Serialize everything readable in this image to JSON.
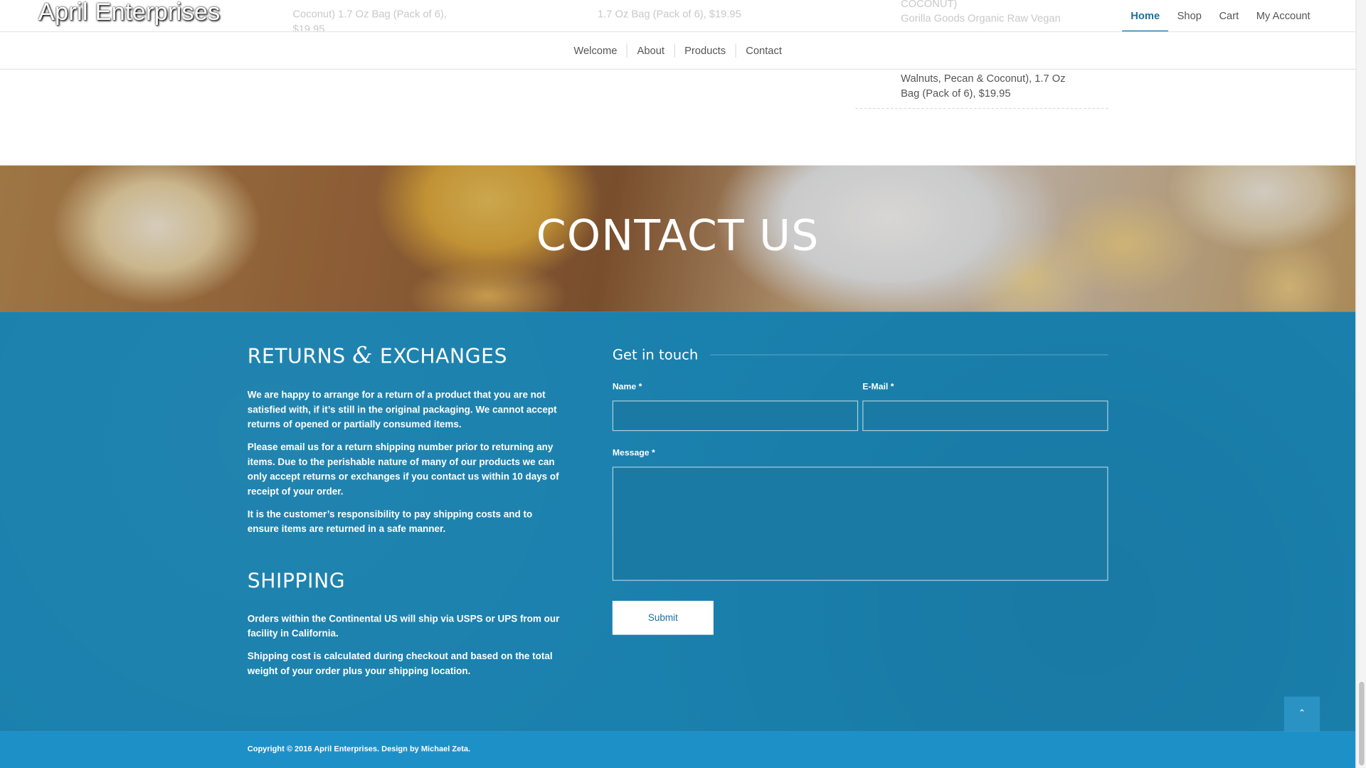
{
  "site": {
    "logo": "April Enterprises"
  },
  "main_nav": [
    "Home",
    "Shop",
    "Cart",
    "My Account"
  ],
  "sub_nav": [
    "Welcome",
    "About",
    "Products",
    "Contact"
  ],
  "ghost_products": {
    "left": "Coconut) 1.7 Oz Bag (Pack of 6), $19.95",
    "middle": "1.7 Oz Bag (Pack of 6), $19.95",
    "right_title": "COCONUT)",
    "right_sub": "Gorilla Goods Organic Raw Vegan"
  },
  "product_tail": "Walnuts, Pecan & Coconut), 1.7 Oz Bag (Pack of 6), $19.95",
  "hero": {
    "title": "CONTACT US"
  },
  "returns": {
    "heading_before": "RETURNS ",
    "heading_amp": "&",
    "heading_after": " EXCHANGES",
    "paragraphs": [
      "We are happy to arrange for a return of a product that you are not satisfied with, if it’s still in the original packaging. We cannot accept returns of opened or partially consumed items.",
      "Please email us for a return shipping number prior to returning any items. Due to the perishable nature of many of our products we can only accept returns or exchanges if you contact us within 10 days of receipt of your order.",
      "It is the customer’s responsibility to pay shipping costs and to ensure items are returned in a safe manner."
    ]
  },
  "shipping": {
    "heading": "SHIPPING",
    "paragraphs": [
      "Orders within the Continental US will ship via USPS or UPS from our facility in California.",
      "Shipping cost is calculated during checkout and based on the total weight of your order plus your shipping location."
    ]
  },
  "form": {
    "heading": "Get in touch",
    "name_label": "Name *",
    "email_label": "E-Mail *",
    "message_label": "Message *",
    "name_value": "",
    "email_value": "",
    "message_value": "",
    "submit_label": "Submit"
  },
  "to_top": {
    "icon": "chevron-up-icon"
  },
  "footer": {
    "copyright": "Copyright © 2016 April Enterprises. Design by Michael Zeta."
  },
  "colors": {
    "contact_bg": "#1a80ad",
    "footer_bg": "#1e90c8",
    "accent": "#1d6f9c"
  }
}
